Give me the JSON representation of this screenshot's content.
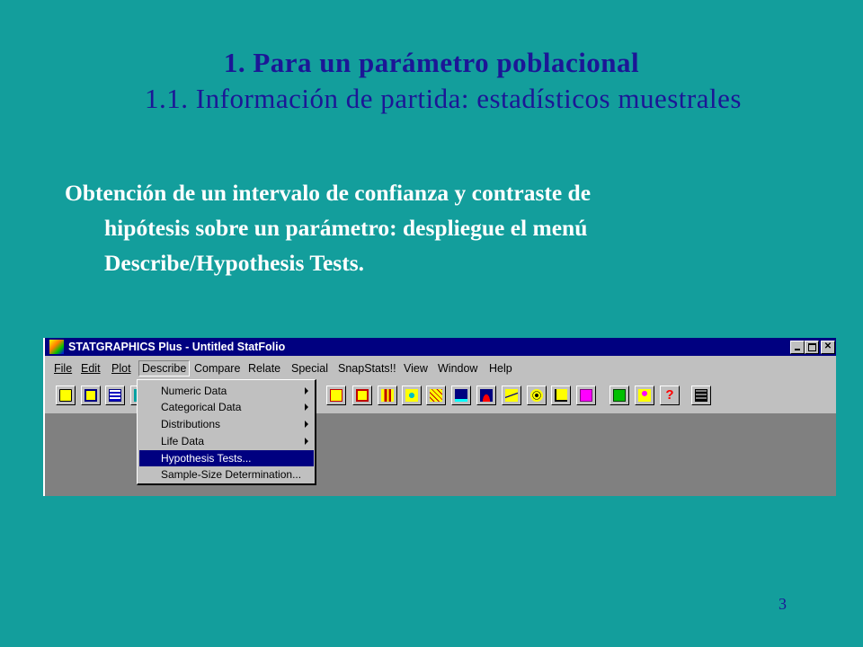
{
  "slide": {
    "title": "1. Para un parámetro poblacional",
    "subtitle": "1.1. Información de partida: estadísticos muestrales",
    "body_lines": [
      "Obtención de un intervalo de confianza y contraste de",
      "hipótesis sobre un parámetro: despliegue el menú",
      "Describe/Hypothesis Tests."
    ],
    "page_number": "3"
  },
  "app": {
    "window_title": "STATGRAPHICS Plus - Untitled StatFolio",
    "menu": [
      "File",
      "Edit",
      "Plot",
      "Describe",
      "Compare",
      "Relate",
      "Special",
      "SnapStats!!",
      "View",
      "Window",
      "Help"
    ],
    "active_menu": "Describe",
    "dropdown_items": [
      {
        "label": "Numeric Data",
        "submenu": true
      },
      {
        "label": "Categorical Data",
        "submenu": true
      },
      {
        "label": "Distributions",
        "submenu": true
      },
      {
        "label": "Life Data",
        "submenu": true
      },
      {
        "label": "Hypothesis Tests...",
        "submenu": false,
        "highlighted": true
      },
      {
        "label": "Sample-Size Determination...",
        "submenu": false
      }
    ],
    "toolbar_icons": [
      "open-folder-icon",
      "save-icon",
      "spreadsheet-icon",
      "chart-icon",
      "scatter-icon",
      "boxplot-icon",
      "histogram-icon",
      "scatter-colored-icon",
      "scatter-grid-icon",
      "timeseries-icon",
      "distribution-icon",
      "trend-icon",
      "target-icon",
      "control-chart-icon",
      "glm-icon",
      "arrow-icon",
      "person-icon",
      "help-icon",
      "calculator-icon"
    ],
    "colors": {
      "slide_background": "#139e9c",
      "title_color": "#1c1696",
      "titlebar": "#000080",
      "highlight": "#000080"
    }
  }
}
